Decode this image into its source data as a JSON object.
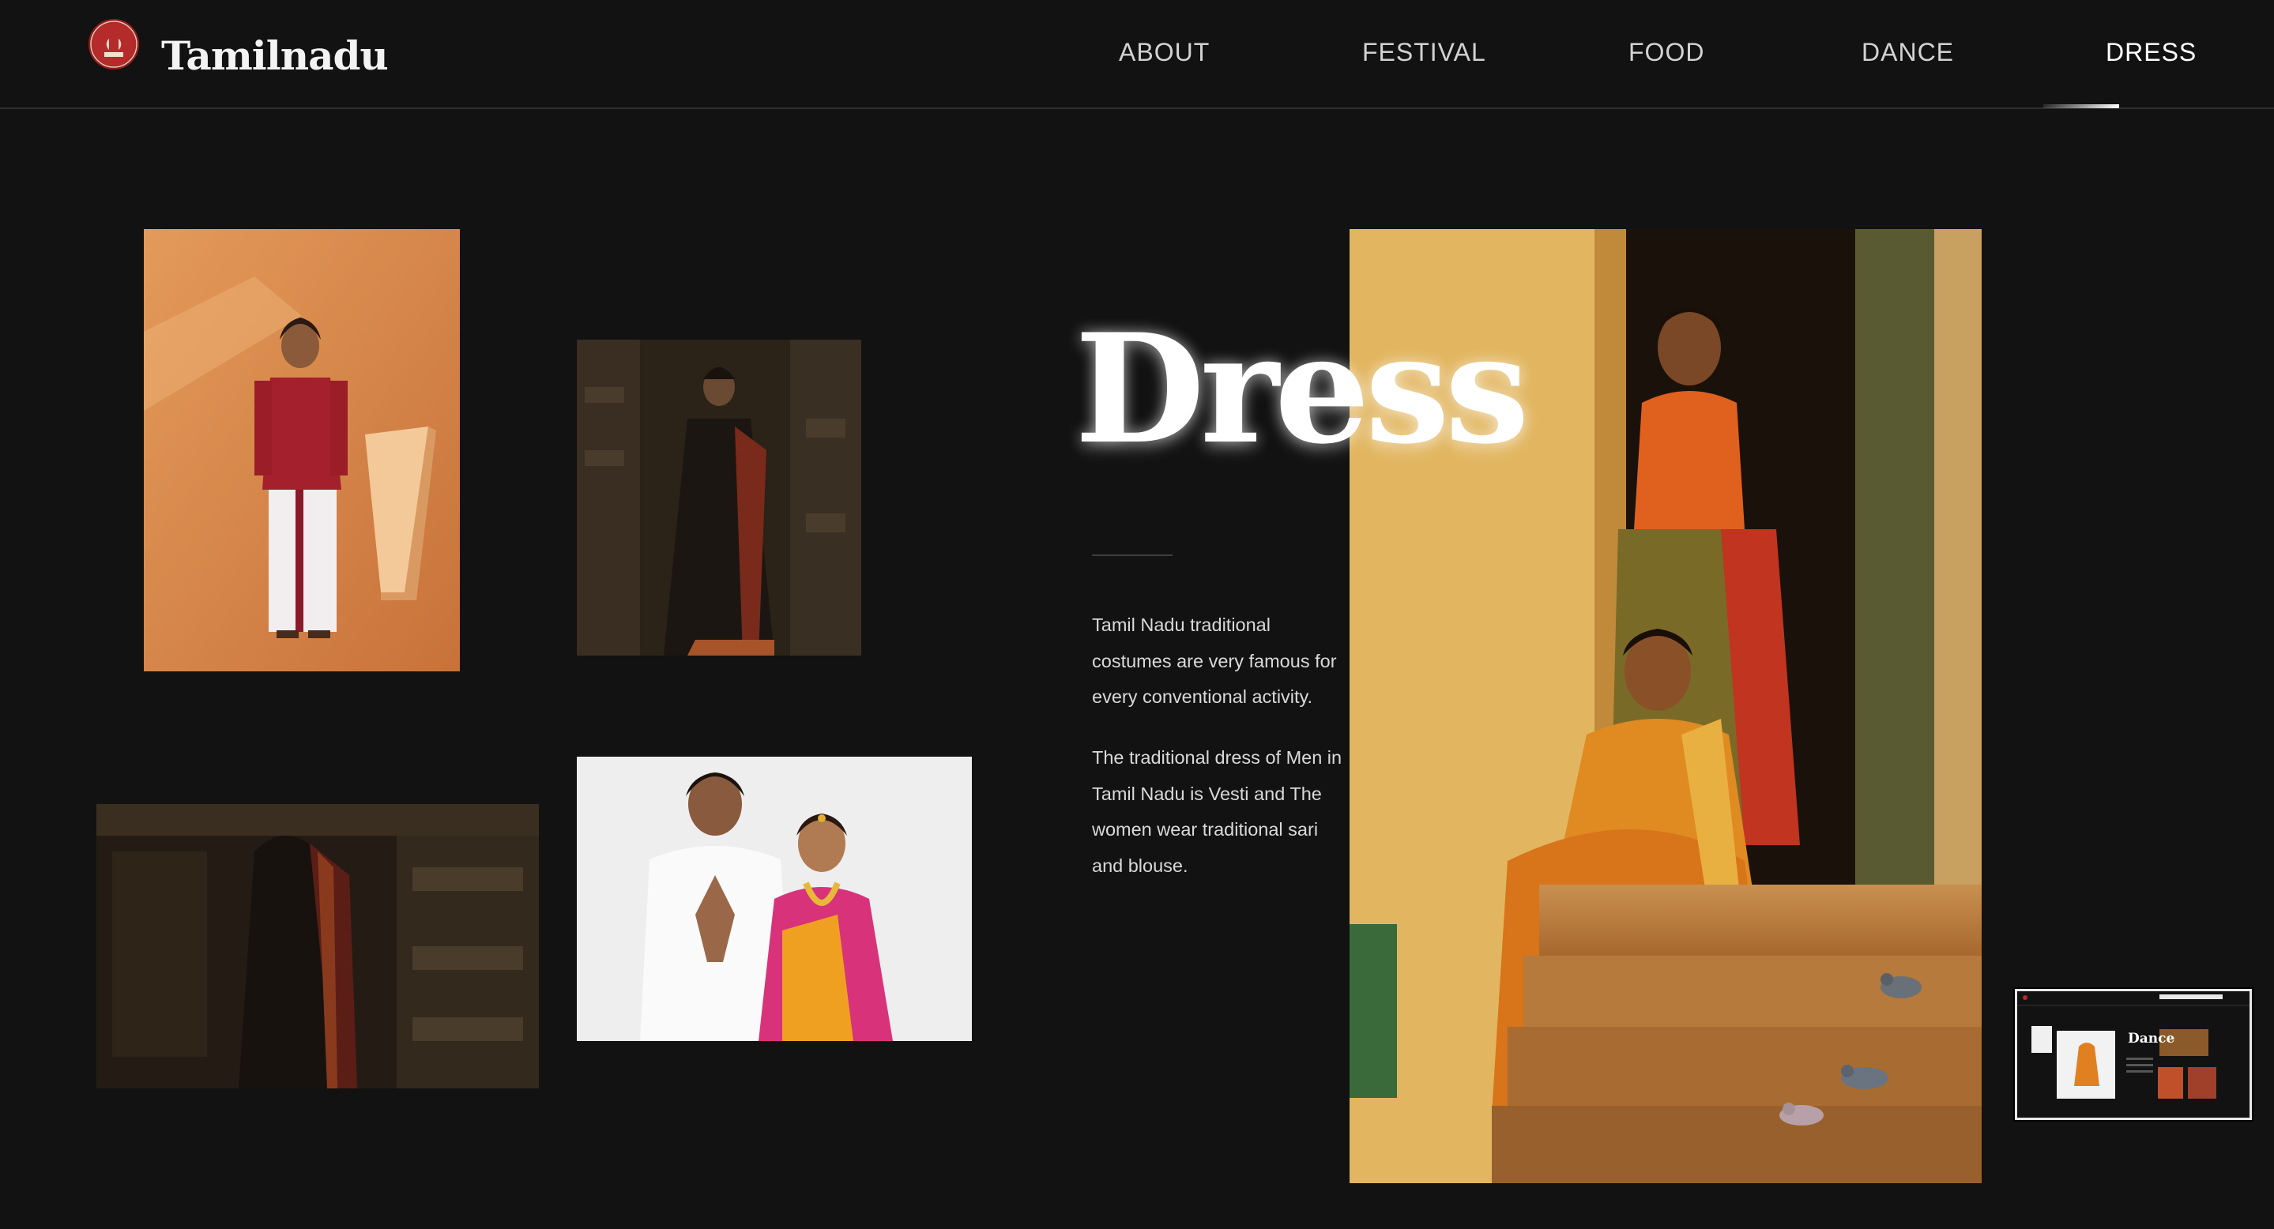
{
  "header": {
    "brand": "Tamilnadu",
    "nav": [
      {
        "label": "ABOUT"
      },
      {
        "label": "FESTIVAL"
      },
      {
        "label": "FOOD"
      },
      {
        "label": "DANCE"
      },
      {
        "label": "DRESS",
        "active": true
      }
    ]
  },
  "main": {
    "title": "Dress",
    "paragraphs": [
      "Tamil Nadu traditional costumes are very famous for every conventional activity.",
      "The traditional dress of Men in Tamil Nadu is Vesti and The women wear traditional sari and blouse."
    ]
  },
  "preview": {
    "title": "Dance"
  },
  "colors": {
    "background": "#121212",
    "text": "#d9d9d9",
    "accent": "#ffffff"
  }
}
